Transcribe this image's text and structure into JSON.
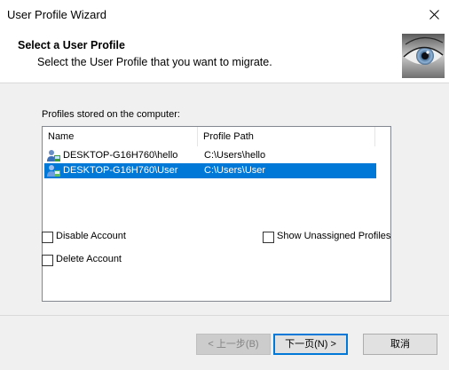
{
  "window": {
    "title": "User Profile Wizard"
  },
  "header": {
    "title": "Select a User Profile",
    "subtitle": "Select the User Profile that you want to migrate."
  },
  "main": {
    "profiles_label": "Profiles stored on the computer:",
    "columns": [
      "Name",
      "Profile Path"
    ],
    "rows": [
      {
        "name": "DESKTOP-G16H760\\hello",
        "path": "C:\\Users\\hello",
        "selected": false
      },
      {
        "name": "DESKTOP-G16H760\\User",
        "path": "C:\\Users\\User",
        "selected": true
      }
    ],
    "checkboxes": {
      "disable_account": {
        "label": "Disable Account",
        "checked": false
      },
      "delete_account": {
        "label": "Delete Account",
        "checked": false
      },
      "show_unassigned": {
        "label": "Show Unassigned Profiles",
        "checked": false
      }
    }
  },
  "footer": {
    "back_label": "< 上一步(B)",
    "next_label": "下一页(N) >",
    "cancel_label": "取消"
  },
  "colors": {
    "selection": "#0078d7",
    "panel": "#f0f0f0"
  },
  "icons": {
    "close": "close-icon",
    "user": "user-profile-icon",
    "eye": "eye-image"
  }
}
